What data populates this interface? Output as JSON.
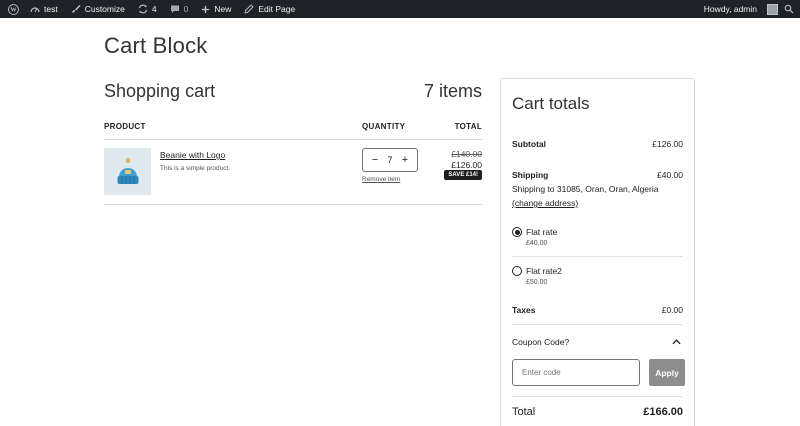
{
  "admin_bar": {
    "site_name": "test",
    "customize": "Customize",
    "updates_count": "4",
    "comments_count": "0",
    "new": "New",
    "edit_page": "Edit Page",
    "howdy": "Howdy, admin"
  },
  "page": {
    "title": "Cart Block"
  },
  "cart": {
    "heading": "Shopping cart",
    "items_count": "7 items",
    "columns": {
      "product": "PRODUCT",
      "quantity": "QUANTITY",
      "total": "TOTAL"
    },
    "items": [
      {
        "name": "Beanie with Logo",
        "description": "This is a simple product.",
        "quantity": "7",
        "remove_label": "Remove item",
        "price_old": "£140.00",
        "price_new": "£126.00",
        "save_badge": "SAVE £14!"
      }
    ]
  },
  "totals": {
    "title": "Cart totals",
    "subtotal_label": "Subtotal",
    "subtotal_value": "£126.00",
    "shipping_label": "Shipping",
    "shipping_value": "£40.00",
    "shipping_to": "Shipping to 31085, Oran, Oran, Algeria",
    "change_address": "(change address)",
    "shipping_options": [
      {
        "label": "Flat rate",
        "price": "£40.00",
        "selected": true
      },
      {
        "label": "Flat rate2",
        "price": "£50.00",
        "selected": false
      }
    ],
    "taxes_label": "Taxes",
    "taxes_value": "£0.00",
    "coupon_label": "Coupon Code?",
    "coupon_placeholder": "Enter code",
    "apply_label": "Apply",
    "total_label": "Total",
    "total_value": "£166.00"
  },
  "colors": {
    "admin_bar_bg": "#1d2327",
    "apply_button_bg": "#8d8d8d",
    "badge_bg": "#1e1e1e",
    "product_thumb_bg": "#dfe9f0"
  }
}
